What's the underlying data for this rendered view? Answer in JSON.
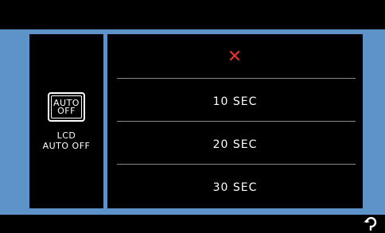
{
  "colors": {
    "background": "#000000",
    "accent_band": "#5d93c8",
    "off_mark": "#e8322c",
    "separator": "#8a8a8a"
  },
  "mode": {
    "icon_line1": "AUTO",
    "icon_line2": "OFF",
    "label_line1": "LCD",
    "label_line2": "AUTO OFF"
  },
  "options": [
    {
      "icon": "close-x-icon"
    },
    {
      "label": "10 SEC"
    },
    {
      "label": "20 SEC"
    },
    {
      "label": "30 SEC"
    }
  ],
  "footer": {
    "back_icon": "return-arrow-icon"
  }
}
